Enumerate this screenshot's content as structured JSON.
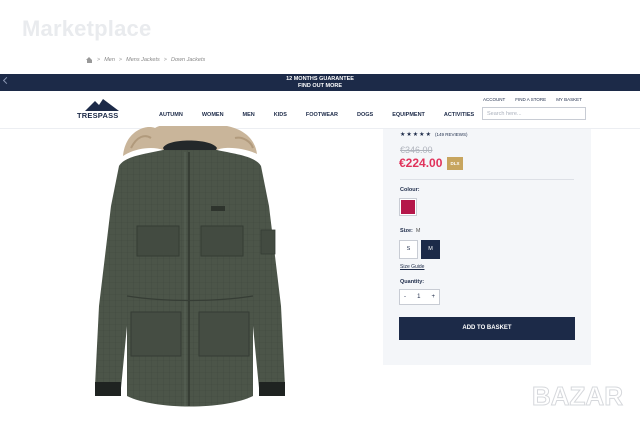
{
  "marketplace": {
    "title": "Marketplace"
  },
  "breadcrumb": {
    "items": [
      "Men",
      "Mens Jackets",
      "Down Jackets"
    ],
    "separator": ">"
  },
  "promo": {
    "line1": "12 MONTHS GUARANTEE",
    "line2": "FIND OUT MORE"
  },
  "header": {
    "logo_text": "TRESPASS",
    "nav": [
      "AUTUMN",
      "WOMEN",
      "MEN",
      "KIDS",
      "FOOTWEAR",
      "DOGS",
      "EQUIPMENT",
      "ACTIVITIES"
    ],
    "utility": [
      "ACCOUNT",
      "FIND A STORE",
      "MY BASKET"
    ],
    "search_placeholder": "Search here..."
  },
  "product": {
    "reviews": "(149 REVIEWS)",
    "rating_out_of_5": 5,
    "old_price": "€346.00",
    "price": "€224.00",
    "discount_badge": "DLX",
    "colour_label": "Colour:",
    "selected_colour": "#b5174a",
    "size_label": "Size:",
    "size_value": "M",
    "sizes": [
      "S",
      "M"
    ],
    "size_guide": "Size Guide",
    "quantity_label": "Quantity:",
    "quantity": "1",
    "qty_minus": "-",
    "qty_plus": "+",
    "add_to_basket": "ADD TO BASKET"
  },
  "watermark": {
    "text": "BAZAR"
  },
  "colors": {
    "navy": "#1c2a48",
    "sale": "#e0325b",
    "badge": "#c7a55f",
    "jacket": "#4a5448"
  }
}
